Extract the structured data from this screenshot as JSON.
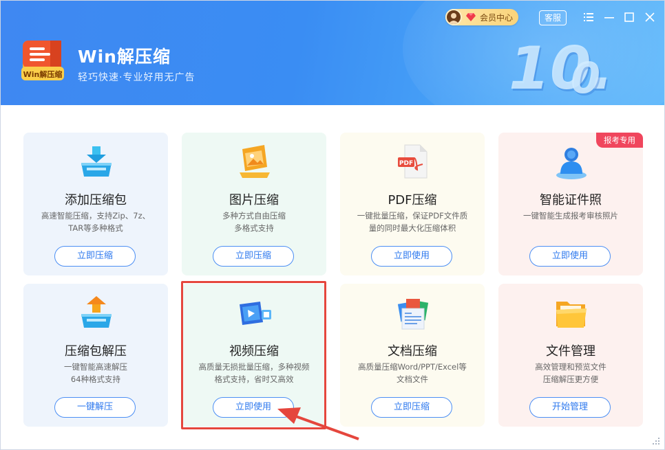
{
  "app": {
    "title": "Win解压缩",
    "subtitle": "轻巧快速·专业好用无广告",
    "logo_text": "Win解压缩",
    "version_major": "10.",
    "version_minor": "0"
  },
  "header": {
    "vip_label": "会员中心",
    "service_label": "客服",
    "window_controls": [
      "menu-icon",
      "minimize-icon",
      "maximize-icon",
      "close-icon"
    ]
  },
  "cards": [
    {
      "title": "添加压缩包",
      "desc": [
        "高速智能压缩，支持Zip、7z、",
        "TAR等多种格式"
      ],
      "button": "立即压缩",
      "icon": "box-download-icon"
    },
    {
      "title": "图片压缩",
      "desc": [
        "多种方式自由压缩",
        "多格式支持"
      ],
      "button": "立即压缩",
      "icon": "image-icon"
    },
    {
      "title": "PDF压缩",
      "desc": [
        "一键批量压缩，保证PDF文件质",
        "量的同时最大化压缩体积"
      ],
      "button": "立即使用",
      "icon": "pdf-icon"
    },
    {
      "title": "智能证件照",
      "desc": [
        "一键智能生成报考审核照片"
      ],
      "button": "立即使用",
      "icon": "person-photo-icon",
      "badge": "报考专用"
    },
    {
      "title": "压缩包解压",
      "desc": [
        "一键智能高速解压",
        "64种格式支持"
      ],
      "button": "一键解压",
      "icon": "box-upload-icon"
    },
    {
      "title": "视频压缩",
      "desc": [
        "高质量无损批量压缩，多种视频",
        "格式支持，省时又高效"
      ],
      "button": "立即使用",
      "icon": "video-icon"
    },
    {
      "title": "文档压缩",
      "desc": [
        "高质量压缩Word/PPT/Excel等",
        "文档文件"
      ],
      "button": "立即压缩",
      "icon": "documents-icon"
    },
    {
      "title": "文件管理",
      "desc": [
        "高效管理和预览文件",
        "压缩解压更方便"
      ],
      "button": "开始管理",
      "icon": "folder-icon"
    }
  ],
  "colors": {
    "header_blue": "#3f88f2",
    "button_blue": "#2d78ee",
    "highlight_red": "#e5463d",
    "badge_red": "#f0465d"
  }
}
